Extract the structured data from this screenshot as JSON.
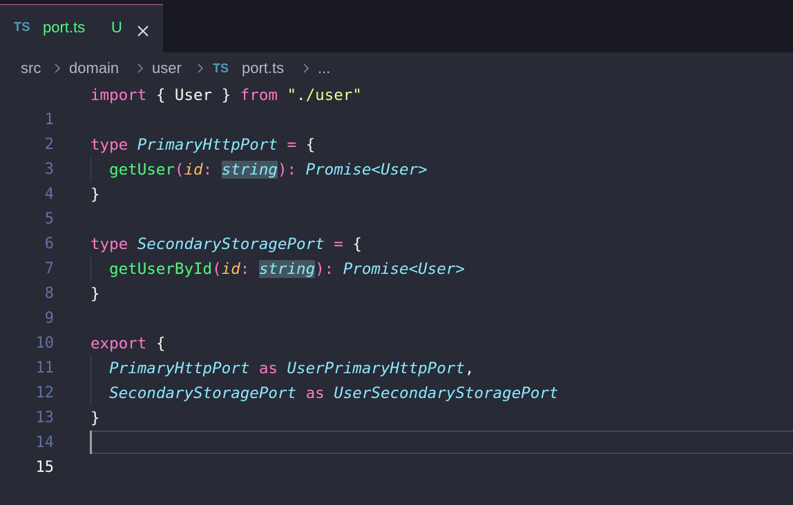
{
  "tab": {
    "language_badge": "TS",
    "file_name": "port.ts",
    "git_status": "U",
    "close_icon": "close-icon"
  },
  "breadcrumb": {
    "items": [
      "src",
      "domain",
      "user"
    ],
    "file_badge": "TS",
    "file": "port.ts",
    "more": "..."
  },
  "editor": {
    "active_line": 15,
    "line_numbers": [
      "1",
      "2",
      "3",
      "4",
      "5",
      "6",
      "7",
      "8",
      "9",
      "10",
      "11",
      "12",
      "13",
      "14",
      "15"
    ],
    "tokens": {
      "l1_import": "import",
      "l1_open": " { ",
      "l1_user": "User",
      "l1_close": " } ",
      "l1_from": "from",
      "l1_space": " ",
      "l1_str": "\"./user\"",
      "l3_type": "type",
      "l3_name": "PrimaryHttpPort",
      "l3_eq": "=",
      "l3_brace": "{",
      "l4_fn": "getUser",
      "l4_paren": "(",
      "l4_param": "id",
      "l4_colon": ": ",
      "l4_type": "string",
      "l4_close": "): ",
      "l4_promise": "Promise",
      "l4_generic": "<User>",
      "l5_brace": "}",
      "l7_type": "type",
      "l7_name": "SecondaryStoragePort",
      "l7_eq": "=",
      "l7_brace": "{",
      "l8_fn": "getUserById",
      "l8_paren": "(",
      "l8_param": "id",
      "l8_colon": ": ",
      "l8_type": "string",
      "l8_close": "): ",
      "l8_promise": "Promise",
      "l8_generic": "<User>",
      "l9_brace": "}",
      "l11_export": "export",
      "l11_brace": "{",
      "l12_name": "PrimaryHttpPort",
      "l12_as": "as",
      "l12_alias": "UserPrimaryHttpPort",
      "l12_comma": ",",
      "l13_name": "SecondaryStoragePort",
      "l13_as": "as",
      "l13_alias": "UserSecondaryStoragePort",
      "l14_brace": "}"
    }
  },
  "colors": {
    "background": "#282a36",
    "tab_bar": "#191a21",
    "keyword": "#ff79c6",
    "string": "#f1fa8c",
    "type": "#8be9fd",
    "function": "#50fa7b",
    "parameter": "#ffb86c",
    "line_number": "#6272a4",
    "ts_badge": "#519aba"
  }
}
